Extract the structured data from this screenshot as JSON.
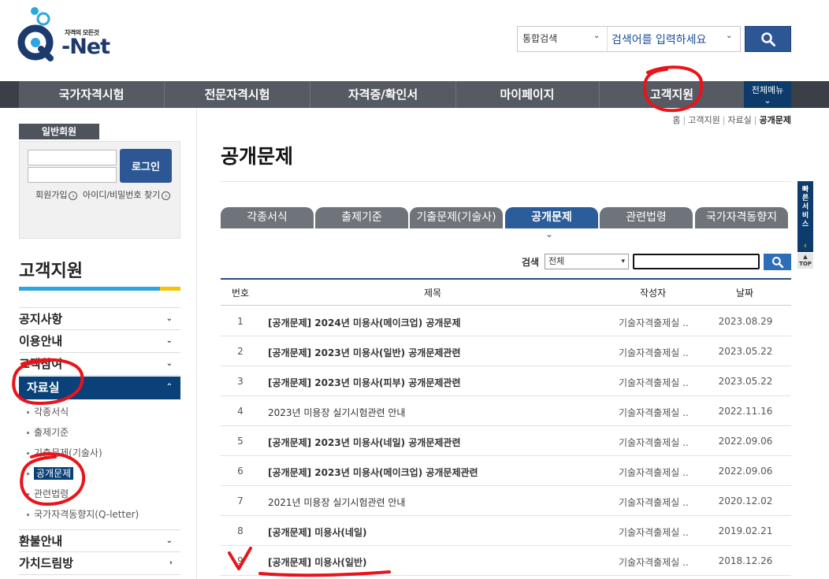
{
  "header": {
    "logo_tagline": "자격의 모든것",
    "logo_text": "-Net",
    "search_type": "통합검색",
    "search_placeholder": "검색어를 입력하세요",
    "search_icon": "search-icon"
  },
  "gnb": {
    "items": [
      {
        "label": "국가자격시험"
      },
      {
        "label": "전문자격시험"
      },
      {
        "label": "자격증/확인서"
      },
      {
        "label": "마이페이지"
      },
      {
        "label": "고객지원"
      }
    ],
    "all_menu_label": "전체메뉴",
    "all_menu_arrow": "⌄"
  },
  "breadcrumb": [
    "홈",
    "고객지원",
    "자료실",
    "공개문제"
  ],
  "login": {
    "tab_label": "일반회원",
    "login_button": "로그인",
    "join_link": "회원가입",
    "find_link": "아이디/비밀번호 찾기"
  },
  "side": {
    "title": "고객지원",
    "items": [
      {
        "label": "공지사항",
        "arrow": "⌄"
      },
      {
        "label": "이용안내",
        "arrow": "⌄"
      },
      {
        "label": "고객참여",
        "arrow": "⌄"
      },
      {
        "label": "자료실",
        "arrow": "⌃"
      },
      {
        "label": "환불안내",
        "arrow": "⌄"
      },
      {
        "label": "가치드림방",
        "arrow": "›"
      }
    ],
    "subitems": [
      {
        "label": "각종서식"
      },
      {
        "label": "출제기준"
      },
      {
        "label": "기출문제(기술사)"
      },
      {
        "label": "공개문제"
      },
      {
        "label": "관련법령"
      },
      {
        "label": "국가자격동향지(Q-letter)"
      }
    ]
  },
  "content": {
    "page_title": "공개문제",
    "tabs": [
      {
        "label": "각종서식"
      },
      {
        "label": "출제기준"
      },
      {
        "label": "기출문제(기술사)"
      },
      {
        "label": "공개문제"
      },
      {
        "label": "관련법령"
      },
      {
        "label": "국가자격동향지"
      }
    ],
    "tab_arrow": "⌄",
    "search": {
      "label": "검색",
      "select_value": "전체",
      "select_arrow": "▾"
    },
    "table": {
      "headers": [
        "번호",
        "제목",
        "작성자",
        "날짜"
      ],
      "rows": [
        {
          "num": "1",
          "title": "[공개문제] 2024년 미용사(메이크업) 공개문제",
          "author": "기술자격출제실 ..",
          "date": "2023.08.29"
        },
        {
          "num": "2",
          "title": "[공개문제] 2023년 미용사(일반) 공개문제관련",
          "author": "기술자격출제실 ..",
          "date": "2023.05.22"
        },
        {
          "num": "3",
          "title": "[공개문제] 2023년 미용사(피부) 공개문제관련",
          "author": "기술자격출제실 ..",
          "date": "2023.05.22"
        },
        {
          "num": "4",
          "title": "2023년 미용장 실기시험관련 안내",
          "author": "기술자격출제실 ..",
          "date": "2022.11.16"
        },
        {
          "num": "5",
          "title": "[공개문제] 2023년 미용사(네일) 공개문제관련",
          "author": "기술자격출제실 ..",
          "date": "2022.09.06"
        },
        {
          "num": "6",
          "title": "[공개문제] 2023년 미용사(메이크업) 공개문제관련",
          "author": "기술자격출제실 ..",
          "date": "2022.09.06"
        },
        {
          "num": "7",
          "title": "2021년 미용장 실기시험관련 안내",
          "author": "기술자격출제실 ..",
          "date": "2020.12.02"
        },
        {
          "num": "8",
          "title": "[공개문제] 미용사(네일)",
          "author": "기술자격출제실 ..",
          "date": "2019.02.21"
        },
        {
          "num": "9",
          "title": "[공개문제] 미용사(일반)",
          "author": "기술자격출제실 ..",
          "date": "2018.12.26"
        }
      ]
    }
  },
  "quick": {
    "label": "빠른서비스",
    "arrow": "‹",
    "top_label": "TOP"
  },
  "colors": {
    "brand_navy": "#0a4178",
    "accent_blue": "#2c5794",
    "annotation_red": "#e8141b"
  }
}
